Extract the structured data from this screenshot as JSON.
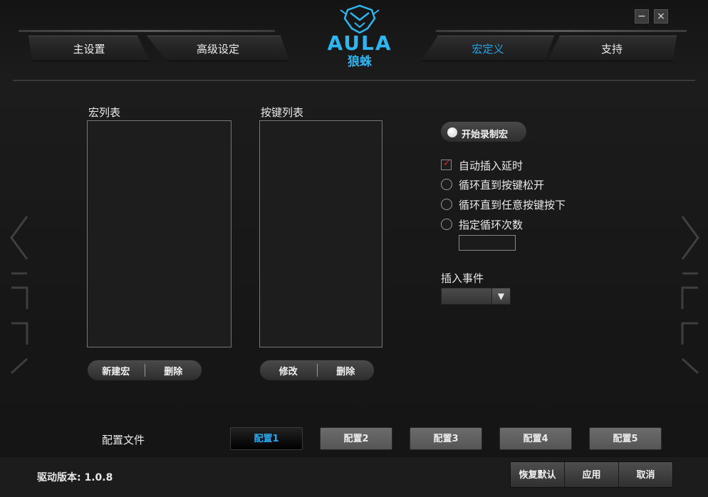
{
  "window": {
    "brand_logo_text": "AULA",
    "brand_logo_subtitle": "狼蛛",
    "minimize_label": "−",
    "close_label": "×"
  },
  "tabs": {
    "main_settings": "主设置",
    "advanced_settings": "高级设定",
    "macro_definition": "宏定义",
    "support": "支持",
    "active": "macro_definition"
  },
  "macro_list": {
    "title": "宏列表",
    "items": [],
    "new_button": "新建宏",
    "delete_button": "删除"
  },
  "key_list": {
    "title": "按键列表",
    "items": [],
    "edit_button": "修改",
    "delete_button": "删除"
  },
  "recording": {
    "start_button": "开始录制宏"
  },
  "options": {
    "auto_insert_delay": {
      "label": "自动插入延时",
      "checked": true
    },
    "loop_until_release": {
      "label": "循环直到按键松开",
      "selected": false
    },
    "loop_until_any_key": {
      "label": "循环直到任意按键按下",
      "selected": false
    },
    "loop_count": {
      "label": "指定循环次数",
      "selected": false,
      "value": ""
    }
  },
  "insert_event": {
    "label": "插入事件",
    "selected": ""
  },
  "profiles": {
    "label": "配置文件",
    "items": [
      "配置1",
      "配置2",
      "配置3",
      "配置4",
      "配置5"
    ],
    "active_index": 0
  },
  "footer": {
    "version_label": "驱动版本:",
    "version_value": "1.0.8",
    "restore_defaults": "恢复默认",
    "apply": "应用",
    "cancel": "取消"
  },
  "colors": {
    "accent": "#27a3e6",
    "check_red": "#d42a2a",
    "background": "#1a1a1a"
  }
}
